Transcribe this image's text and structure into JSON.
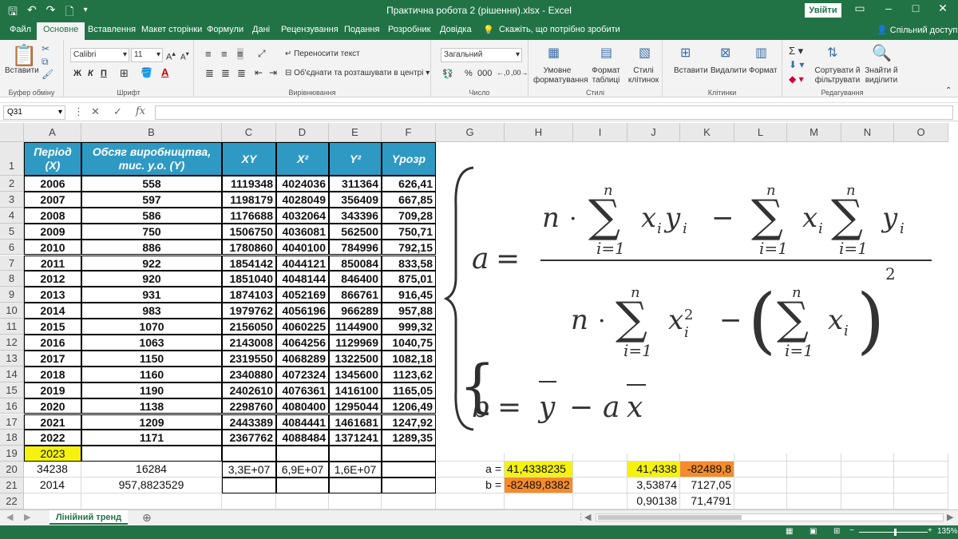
{
  "app": {
    "title": "Практична робота 2 (рішення).xlsx  -  Excel",
    "signin": "Увійти",
    "share": "Спільний доступ"
  },
  "tabs": [
    "Файл",
    "Основне",
    "Вставлення",
    "Макет сторінки",
    "Формули",
    "Дані",
    "Рецензування",
    "Подання",
    "Розробник",
    "Довідка"
  ],
  "tellme": "Скажіть, що потрібно зробити",
  "ribbon": {
    "clipboard": {
      "paste": "Вставити",
      "label": "Буфер обміну"
    },
    "font": {
      "name": "Calibri",
      "size": "11",
      "label": "Шрифт",
      "bold": "Ж",
      "italic": "К",
      "underline": "П"
    },
    "align": {
      "wrap": "Переносити текст",
      "merge": "Об'єднати та розташувати в центрі",
      "label": "Вирівнювання"
    },
    "number": {
      "format": "Загальний",
      "label": "Число"
    },
    "styles": {
      "cond": "Умовне форматування",
      "table": "Формат таблиці",
      "cell": "Стилі клітинок",
      "label": "Стилі"
    },
    "cells": {
      "insert": "Вставити",
      "delete": "Видалити",
      "format": "Формат",
      "label": "Клітинки"
    },
    "edit": {
      "sort": "Сортувати й фільтрувати",
      "find": "Знайти й виділити",
      "label": "Редагування"
    }
  },
  "namebox": "Q31",
  "columns": [
    "A",
    "B",
    "C",
    "D",
    "E",
    "F",
    "G",
    "H",
    "I",
    "J",
    "K",
    "L",
    "M",
    "N",
    "O"
  ],
  "rows": [
    "1",
    "2",
    "3",
    "4",
    "5",
    "6",
    "7",
    "8",
    "9",
    "10",
    "11",
    "12",
    "13",
    "14",
    "15",
    "16",
    "17",
    "18",
    "19",
    "20",
    "21",
    "22"
  ],
  "headers": {
    "a1": "Період (X)",
    "b1": "Обсяг виробництва, тис. у.о. (Y)",
    "c1": "XY",
    "d1": "X²",
    "e1": "Y²",
    "f1": "Yрозр"
  },
  "table": [
    [
      "2006",
      "558",
      "1119348",
      "4024036",
      "311364",
      "626,41"
    ],
    [
      "2007",
      "597",
      "1198179",
      "4028049",
      "356409",
      "667,85"
    ],
    [
      "2008",
      "586",
      "1176688",
      "4032064",
      "343396",
      "709,28"
    ],
    [
      "2009",
      "750",
      "1506750",
      "4036081",
      "562500",
      "750,71"
    ],
    [
      "2010",
      "886",
      "1780860",
      "4040100",
      "784996",
      "792,15"
    ],
    [
      "2011",
      "922",
      "1854142",
      "4044121",
      "850084",
      "833,58"
    ],
    [
      "2012",
      "920",
      "1851040",
      "4048144",
      "846400",
      "875,01"
    ],
    [
      "2013",
      "931",
      "1874103",
      "4052169",
      "866761",
      "916,45"
    ],
    [
      "2014",
      "983",
      "1979762",
      "4056196",
      "966289",
      "957,88"
    ],
    [
      "2015",
      "1070",
      "2156050",
      "4060225",
      "1144900",
      "999,32"
    ],
    [
      "2016",
      "1063",
      "2143008",
      "4064256",
      "1129969",
      "1040,75"
    ],
    [
      "2017",
      "1150",
      "2319550",
      "4068289",
      "1322500",
      "1082,18"
    ],
    [
      "2018",
      "1160",
      "2340880",
      "4072324",
      "1345600",
      "1123,62"
    ],
    [
      "2019",
      "1190",
      "2402610",
      "4076361",
      "1416100",
      "1165,05"
    ],
    [
      "2020",
      "1138",
      "2298760",
      "4080400",
      "1295044",
      "1206,49"
    ],
    [
      "2021",
      "1209",
      "2443389",
      "4084441",
      "1461681",
      "1247,92"
    ],
    [
      "2022",
      "1171",
      "2367762",
      "4088484",
      "1371241",
      "1289,35"
    ]
  ],
  "row19": {
    "a": "2023"
  },
  "row20": {
    "a": "34238",
    "b": "16284",
    "c": "3,3E+07",
    "d": "6,9E+07",
    "e": "1,6E+07",
    "g": "a =",
    "h": "41,4338235",
    "j": "41,4338",
    "k": "-82489,8"
  },
  "row21": {
    "a": "2014",
    "b": "957,8823529",
    "g": "b =",
    "h": "-82489,8382",
    "j": "3,53874",
    "k": "7127,05"
  },
  "row22": {
    "j": "0,90138",
    "k": "71,4791"
  },
  "sheet": {
    "tab": "Лінійний тренд"
  },
  "status": {
    "zoom": "135%"
  }
}
